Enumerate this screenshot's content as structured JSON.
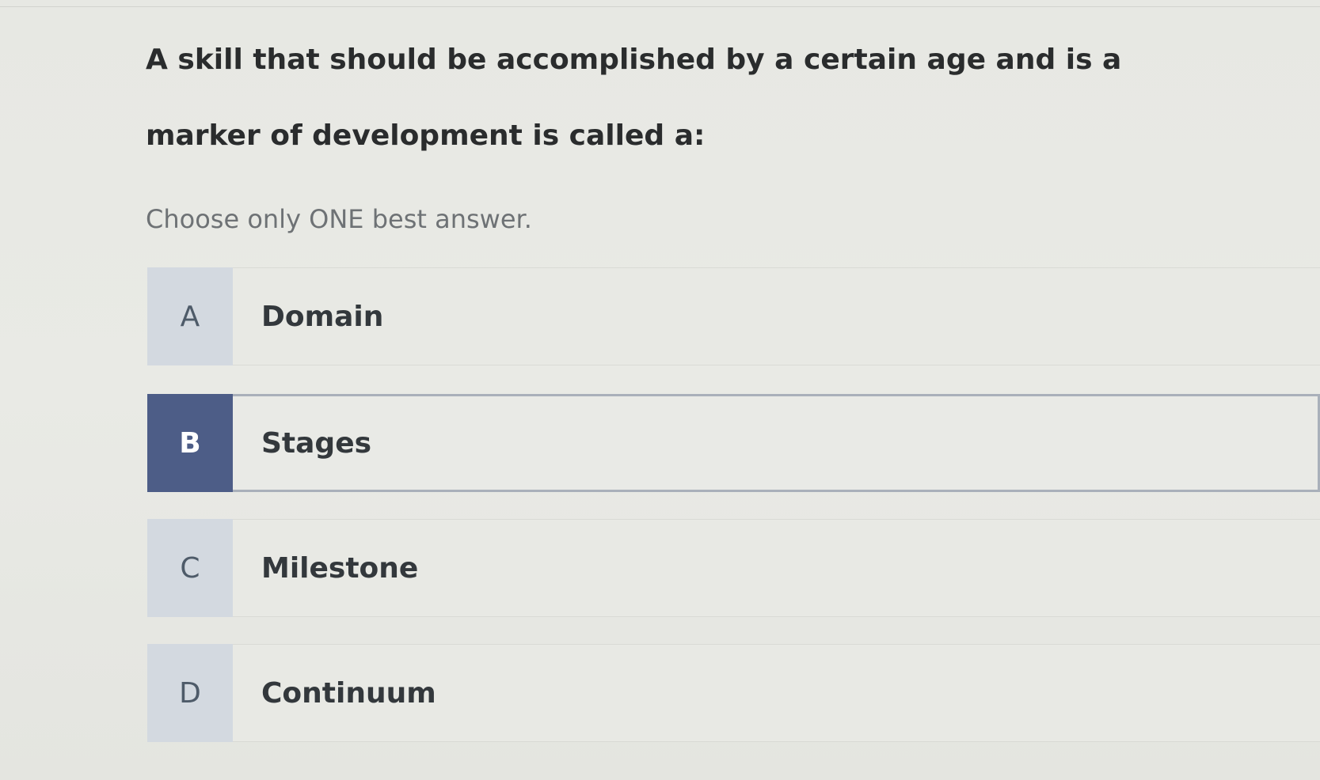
{
  "question": {
    "text": "A skill that should be accomplished by a certain age and is a marker of development is called a:",
    "instruction": "Choose only ONE best answer."
  },
  "options": [
    {
      "letter": "A",
      "label": "Domain",
      "selected": false
    },
    {
      "letter": "B",
      "label": "Stages",
      "selected": true
    },
    {
      "letter": "C",
      "label": "Milestone",
      "selected": false
    },
    {
      "letter": "D",
      "label": "Continuum",
      "selected": false
    }
  ],
  "colors": {
    "background": "#e8e9e4",
    "selected_accent": "#4d5d87",
    "unselected_letter_bg": "#d3d9e0",
    "text": "#2a2c2d"
  }
}
